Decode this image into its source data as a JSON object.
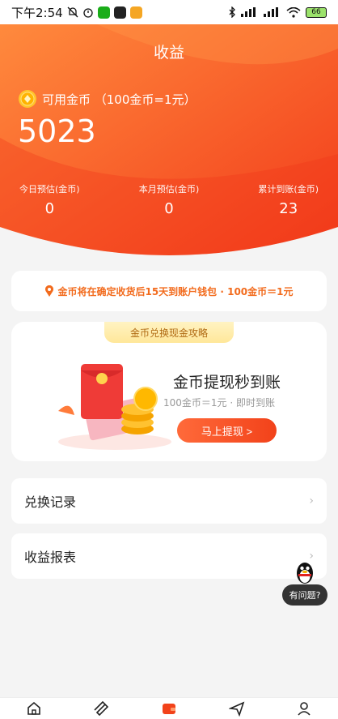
{
  "status_bar": {
    "time": "下午2:54",
    "battery": "66"
  },
  "header": {
    "title": "收益",
    "coin_label": "可用金币 （100金币=1元）",
    "balance": "5023",
    "stats": [
      {
        "label": "今日预估(金币)",
        "value": "0"
      },
      {
        "label": "本月预估(金币)",
        "value": "0"
      },
      {
        "label": "累计到账(金币)",
        "value": "23"
      }
    ]
  },
  "notice": {
    "text": "金币将在确定收货后15天到账户钱包 · 100金币＝1元"
  },
  "promo": {
    "tab": "金币兑换现金攻略",
    "title": "金币提现秒到账",
    "subtitle": "100金币＝1元 · 即时到账",
    "button": "马上提现 >"
  },
  "menu": [
    {
      "label": "兑换记录"
    },
    {
      "label": "收益报表"
    }
  ],
  "help": {
    "label": "有问题?"
  },
  "tabbar": [
    {
      "icon": "home-icon"
    },
    {
      "icon": "ticket-icon"
    },
    {
      "icon": "wallet-icon"
    },
    {
      "icon": "send-icon"
    },
    {
      "icon": "user-icon"
    }
  ],
  "colors": {
    "accent": "#f2421a",
    "header_start": "#ff8a3d",
    "header_end": "#f23a1a"
  }
}
